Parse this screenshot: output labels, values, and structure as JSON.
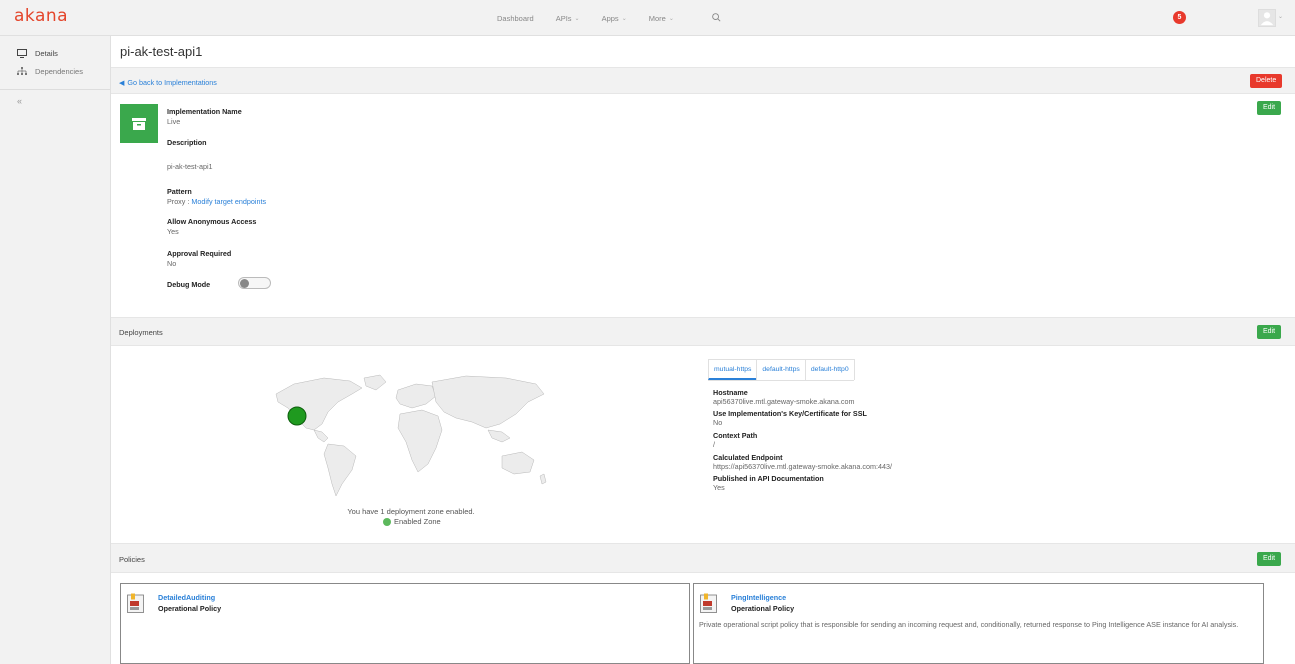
{
  "header": {
    "logo": "akana",
    "nav": [
      {
        "label": "Dashboard",
        "chevron": false
      },
      {
        "label": "APIs",
        "chevron": true
      },
      {
        "label": "Apps",
        "chevron": true
      },
      {
        "label": "More",
        "chevron": true
      }
    ],
    "notification_count": "5"
  },
  "sidebar": {
    "items": [
      {
        "label": "Details",
        "icon": "monitor-icon"
      },
      {
        "label": "Dependencies",
        "icon": "sitemap-icon"
      }
    ],
    "collapse_glyph": "«"
  },
  "page": {
    "title": "pi-ak-test-api1",
    "back_link": "Go back to Implementations",
    "delete_label": "Delete"
  },
  "details": {
    "edit_label": "Edit",
    "implementation_name_label": "Implementation Name",
    "implementation_name": "Live",
    "description_label": "Description",
    "description": "pi-ak-test-api1",
    "pattern_label": "Pattern",
    "pattern_prefix": "Proxy : ",
    "pattern_link": "Modify target endpoints",
    "anonymous_label": "Allow Anonymous Access",
    "anonymous_value": "Yes",
    "approval_label": "Approval Required",
    "approval_value": "No",
    "debug_label": "Debug Mode",
    "debug_enabled": false
  },
  "deployments": {
    "title": "Deployments",
    "edit_label": "Edit",
    "zone_text": "You have 1 deployment zone enabled.",
    "legend": "Enabled Zone",
    "zone_color": "#1f9a1f",
    "tabs": [
      "mutual-https",
      "default-https",
      "default-http0"
    ],
    "active_tab": 0,
    "hostname_label": "Hostname",
    "hostname": "api56370live.mtl.gateway-smoke.akana.com",
    "ssl_label": "Use Implementation's Key/Certificate for SSL",
    "ssl_value": "No",
    "context_label": "Context Path",
    "context_value": "/",
    "endpoint_label": "Calculated Endpoint",
    "endpoint_value": "https://api56370live.mtl.gateway-smoke.akana.com:443/",
    "published_label": "Published in API Documentation",
    "published_value": "Yes"
  },
  "policies": {
    "title": "Policies",
    "edit_label": "Edit",
    "items": [
      {
        "name": "DetailedAuditing",
        "type": "Operational Policy",
        "description": ""
      },
      {
        "name": "PingIntelligence",
        "type": "Operational Policy",
        "description": "Private operational script policy that is responsible for sending an incoming request and, conditionally, returned response to Ping Intelligence ASE instance for AI analysis."
      }
    ]
  },
  "colors": {
    "accent_blue": "#2a80d8",
    "danger": "#e8392c",
    "success": "#3aa84c",
    "logo": "#e4452b"
  }
}
